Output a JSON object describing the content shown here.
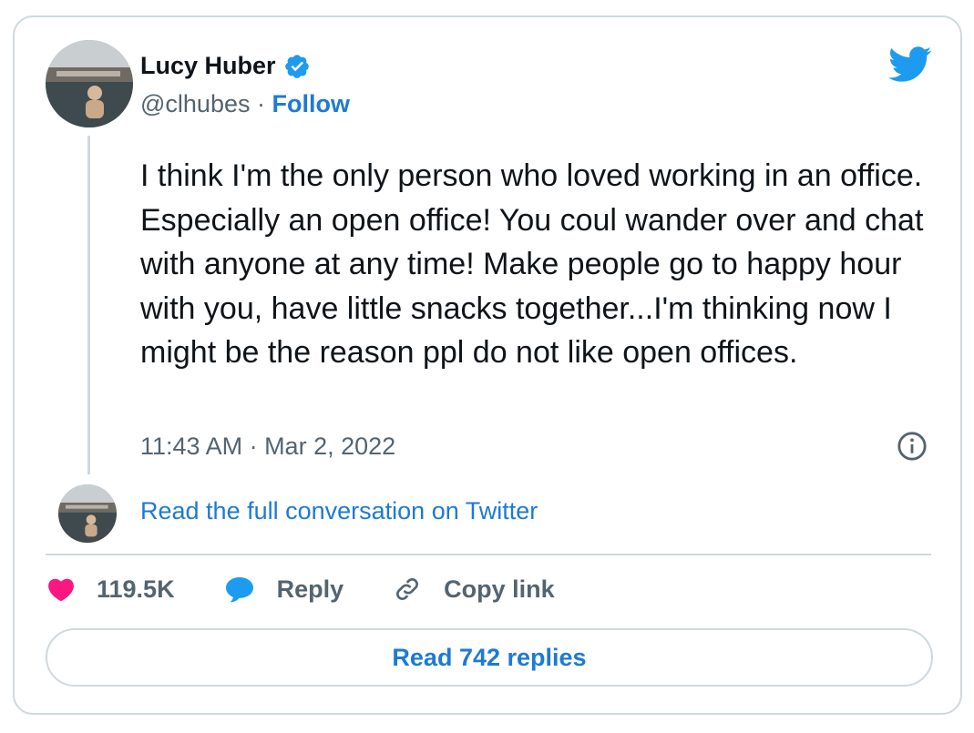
{
  "author": {
    "name": "Lucy Huber",
    "handle": "@clhubes",
    "separator": "·",
    "follow_label": "Follow",
    "verified_icon": "verified-badge-icon"
  },
  "tweet": {
    "text": "I think I'm the only person who loved working in an office. Especially an open office! You coul wander over and chat with anyone at any time! Make people go to happy hour with you, have little snacks together...I'm thinking now I might be the reason ppl do not like open offices.",
    "timestamp": "11:43 AM · Mar 2, 2022"
  },
  "conversation": {
    "read_full_label": "Read the full conversation on Twitter"
  },
  "actions": {
    "like_count": "119.5K",
    "reply_label": "Reply",
    "copy_link_label": "Copy link"
  },
  "footer": {
    "read_replies_label": "Read 742 replies"
  },
  "colors": {
    "brand_blue": "#1d9bf0",
    "link_blue": "#1d7ad6",
    "like_pink": "#f91880",
    "secondary_text": "#536471",
    "border": "#cfd9de"
  }
}
